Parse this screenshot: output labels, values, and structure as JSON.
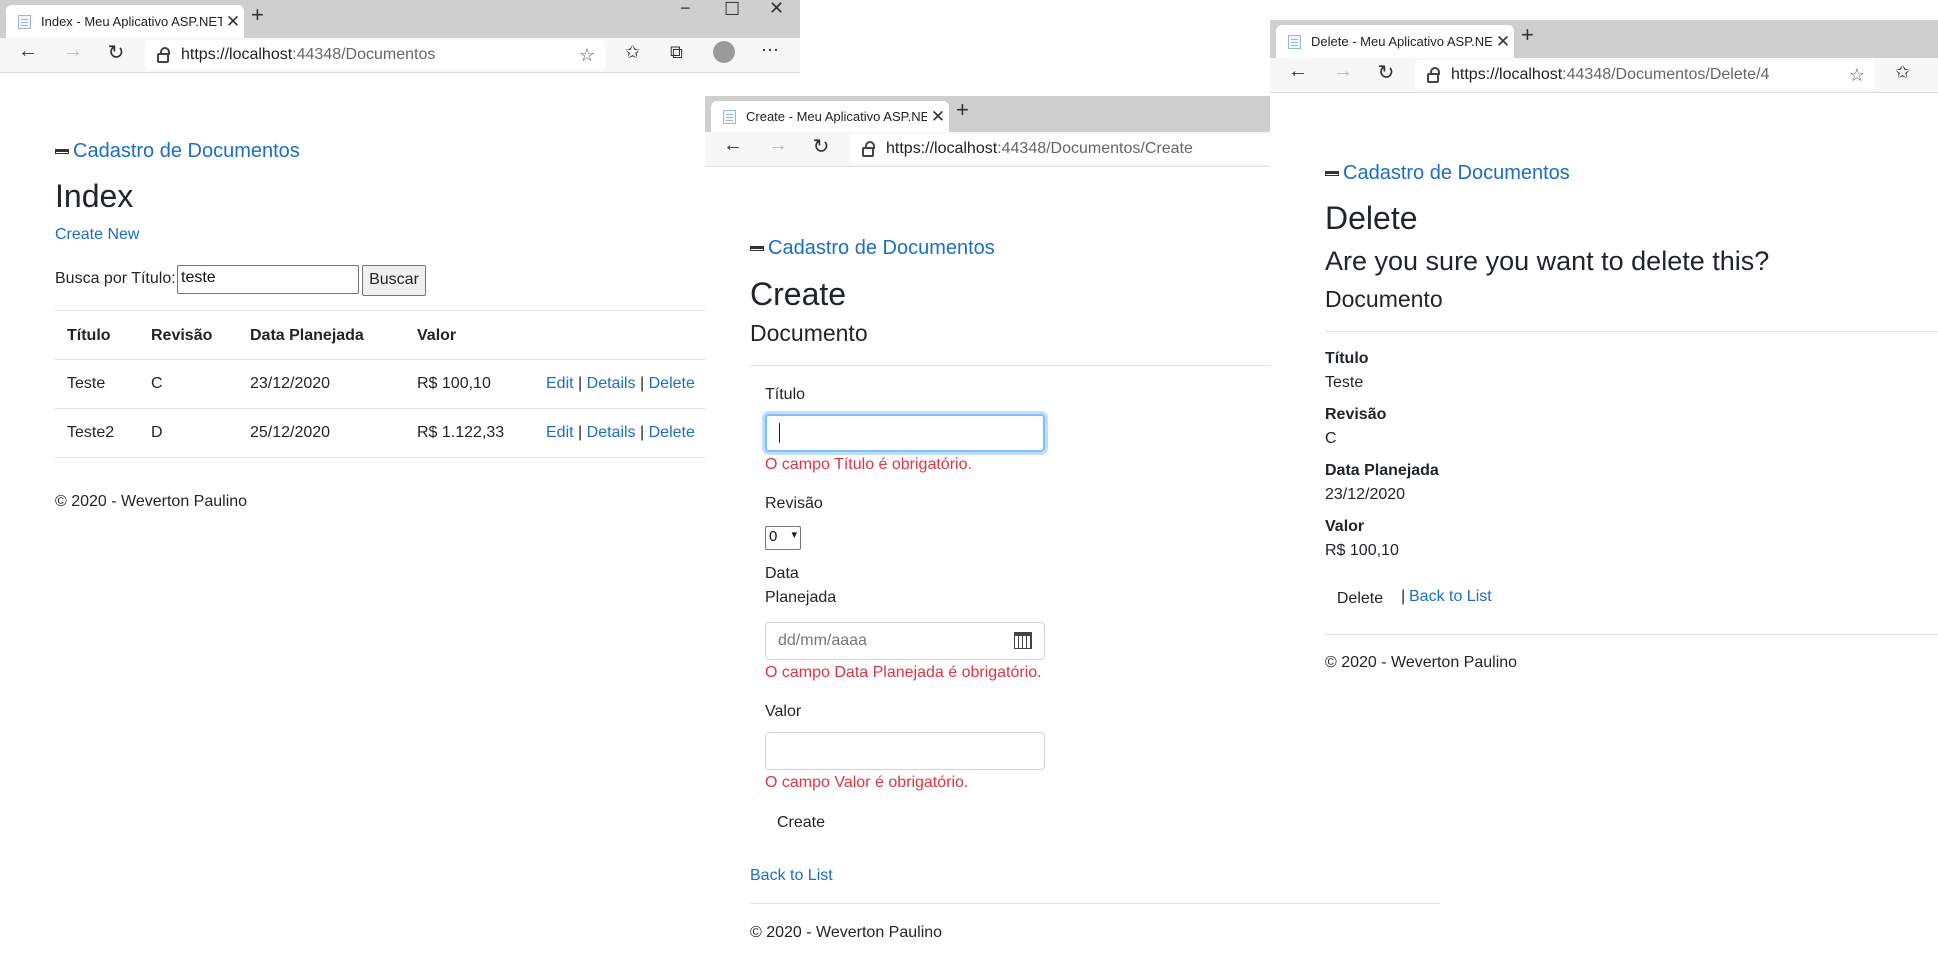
{
  "colors": {
    "link": "#1b6ec2",
    "error": "#dc3545",
    "tabstrip": "#cfcfcf"
  },
  "win1": {
    "tab_title": "Index - Meu Aplicativo ASP.NET",
    "url_host": "https://localhost",
    "url_path": ":44348/Documentos",
    "brand": "Cadastro de Documentos",
    "heading": "Index",
    "create_new": "Create New",
    "search_label": "Busca por Título:",
    "search_value": "teste",
    "search_button": "Buscar",
    "table": {
      "headers": [
        "Título",
        "Revisão",
        "Data Planejada",
        "Valor"
      ],
      "rows": [
        {
          "titulo": "Teste",
          "revisao": "C",
          "data": "23/12/2020",
          "valor": "R$ 100,10"
        },
        {
          "titulo": "Teste2",
          "revisao": "D",
          "data": "25/12/2020",
          "valor": "R$ 1.122,33"
        }
      ],
      "actions": {
        "edit": "Edit",
        "details": "Details",
        "delete": "Delete",
        "sep": "|"
      }
    },
    "footer": "© 2020 - Weverton Paulino"
  },
  "win2": {
    "tab_title": "Create - Meu Aplicativo ASP.NET",
    "url_host": "https://localhost",
    "url_path": ":44348/Documentos/Create",
    "brand": "Cadastro de Documentos",
    "heading": "Create",
    "subheading": "Documento",
    "label_titulo": "Título",
    "error_titulo": "O campo Título é obrigatório.",
    "label_revisao": "Revisão",
    "revisao_value": "0",
    "label_data_1": "Data",
    "label_data_2": "Planejada",
    "data_placeholder": "dd/mm/aaaa",
    "error_data": "O campo Data Planejada é obrigatório.",
    "label_valor": "Valor",
    "error_valor": "O campo Valor é obrigatório.",
    "create_button": "Create",
    "back_link": "Back to List",
    "footer": "© 2020 - Weverton Paulino"
  },
  "win3": {
    "tab_title": "Delete - Meu Aplicativo ASP.NET",
    "url_host": "https://localhost",
    "url_path": ":44348/Documentos/Delete/4",
    "brand": "Cadastro de Documentos",
    "heading": "Delete",
    "question": "Are you sure you want to delete this?",
    "subheading": "Documento",
    "fields": [
      {
        "label": "Título",
        "value": "Teste"
      },
      {
        "label": "Revisão",
        "value": "C"
      },
      {
        "label": "Data Planejada",
        "value": "23/12/2020"
      },
      {
        "label": "Valor",
        "value": "R$ 100,10"
      }
    ],
    "delete_button": "Delete",
    "sep": "|",
    "back_link": "Back to List",
    "footer": "© 2020 - Weverton Paulino"
  }
}
